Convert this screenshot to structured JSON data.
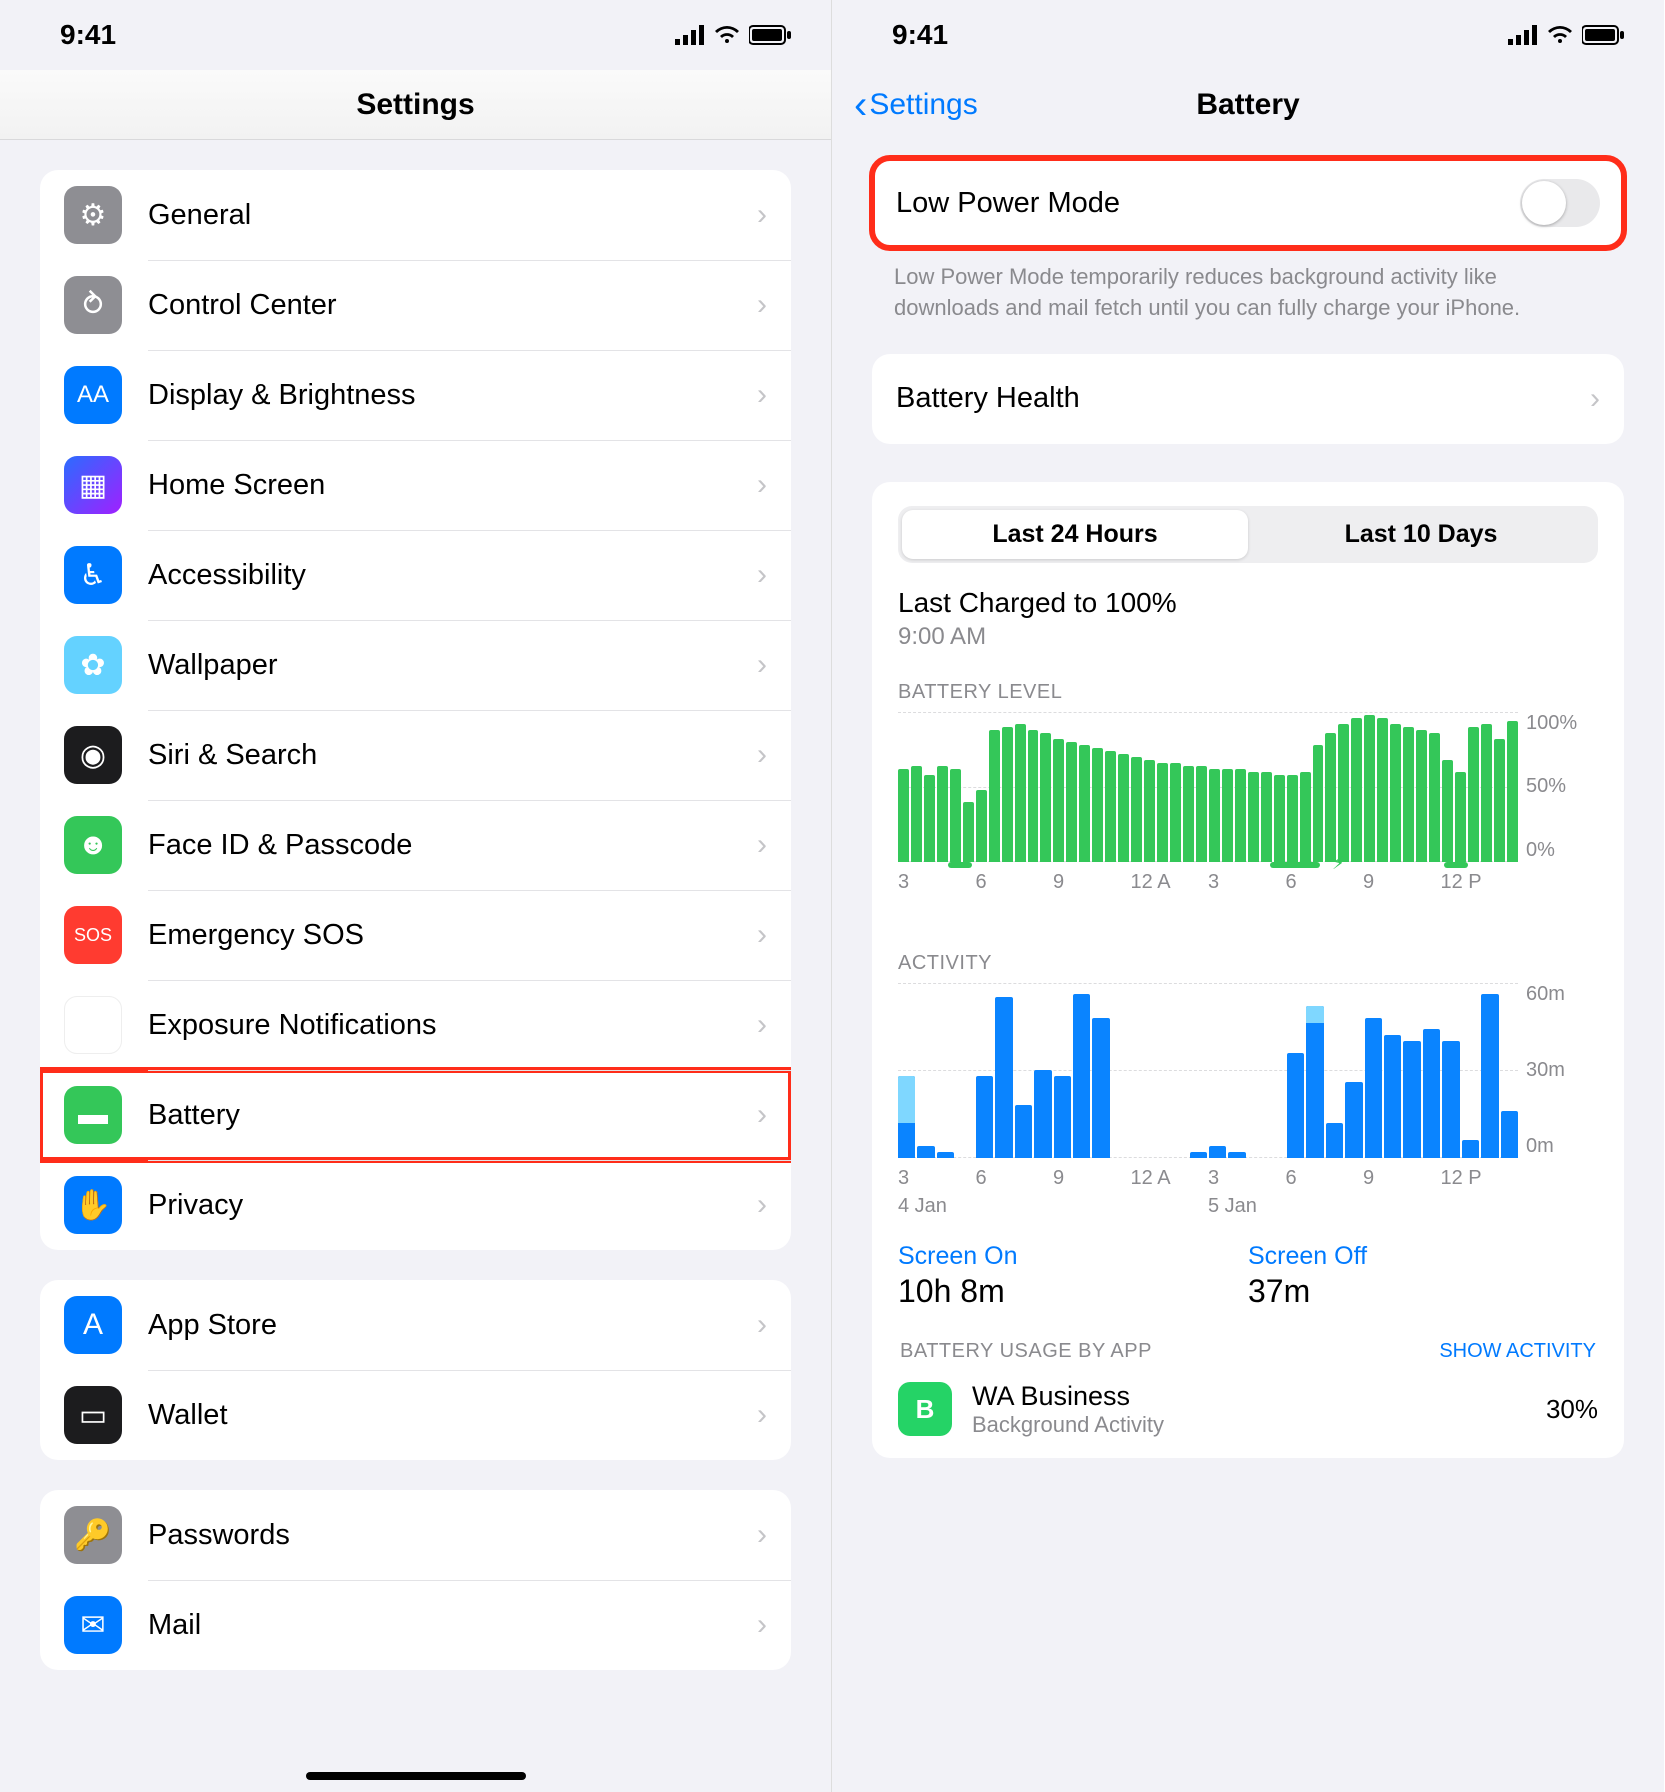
{
  "status": {
    "time": "9:41"
  },
  "left": {
    "title": "Settings",
    "groups": [
      [
        {
          "key": "general",
          "label": "General"
        },
        {
          "key": "control-center",
          "label": "Control Center"
        },
        {
          "key": "display",
          "label": "Display & Brightness"
        },
        {
          "key": "home-screen",
          "label": "Home Screen"
        },
        {
          "key": "accessibility",
          "label": "Accessibility"
        },
        {
          "key": "wallpaper",
          "label": "Wallpaper"
        },
        {
          "key": "siri",
          "label": "Siri & Search"
        },
        {
          "key": "faceid",
          "label": "Face ID & Passcode"
        },
        {
          "key": "sos",
          "label": "Emergency SOS"
        },
        {
          "key": "exposure",
          "label": "Exposure Notifications"
        },
        {
          "key": "battery",
          "label": "Battery",
          "highlight": true
        },
        {
          "key": "privacy",
          "label": "Privacy"
        }
      ],
      [
        {
          "key": "appstore",
          "label": "App Store"
        },
        {
          "key": "wallet",
          "label": "Wallet"
        }
      ],
      [
        {
          "key": "passwords",
          "label": "Passwords"
        },
        {
          "key": "mail",
          "label": "Mail"
        }
      ]
    ]
  },
  "right": {
    "back": "Settings",
    "title": "Battery",
    "low_power": {
      "label": "Low Power Mode",
      "on": false,
      "highlight": true
    },
    "low_power_note": "Low Power Mode temporarily reduces background activity like downloads and mail fetch until you can fully charge your iPhone.",
    "battery_health": "Battery Health",
    "segments": {
      "a": "Last 24 Hours",
      "b": "Last 10 Days",
      "active": "a"
    },
    "charged": {
      "title": "Last Charged to 100%",
      "time": "9:00 AM"
    },
    "level_label": "BATTERY LEVEL",
    "activity_label": "ACTIVITY",
    "x_ticks": [
      "3",
      "6",
      "9",
      "12 A",
      "3",
      "6",
      "9",
      "12 P"
    ],
    "x_dates": [
      "4 Jan",
      "5 Jan"
    ],
    "level_yticks": [
      "100%",
      "50%",
      "0%"
    ],
    "activity_yticks": [
      "60m",
      "30m",
      "0m"
    ],
    "screen_on": {
      "k": "Screen On",
      "v": "10h 8m"
    },
    "screen_off": {
      "k": "Screen Off",
      "v": "37m"
    },
    "apps_label": "BATTERY USAGE BY APP",
    "show_activity": "SHOW ACTIVITY",
    "app": {
      "name": "WA Business",
      "sub": "Background Activity",
      "pct": "30%"
    }
  },
  "chart_data": [
    {
      "type": "bar",
      "title": "BATTERY LEVEL",
      "ylabel": "%",
      "ylim": [
        0,
        100
      ],
      "x_ticks": [
        "3",
        "6",
        "9",
        "12 A",
        "3",
        "6",
        "9",
        "12 P"
      ],
      "values": [
        62,
        64,
        58,
        64,
        62,
        40,
        48,
        88,
        90,
        92,
        88,
        86,
        82,
        80,
        78,
        76,
        74,
        72,
        70,
        68,
        66,
        66,
        64,
        64,
        62,
        62,
        62,
        60,
        60,
        58,
        58,
        60,
        78,
        86,
        92,
        96,
        98,
        96,
        92,
        90,
        88,
        86,
        68,
        60,
        90,
        92,
        82,
        94
      ]
    },
    {
      "type": "bar",
      "title": "ACTIVITY",
      "ylabel": "minutes",
      "ylim": [
        0,
        60
      ],
      "x_ticks": [
        "3",
        "6",
        "9",
        "12 A",
        "3",
        "6",
        "9",
        "12 P"
      ],
      "series": [
        {
          "name": "screen-on",
          "values": [
            12,
            4,
            2,
            0,
            28,
            55,
            18,
            30,
            28,
            56,
            48,
            0,
            0,
            0,
            0,
            2,
            4,
            2,
            0,
            0,
            36,
            46,
            12,
            26,
            48,
            42,
            40,
            44,
            40,
            6,
            56,
            16
          ]
        },
        {
          "name": "screen-off-light",
          "values": [
            16,
            0,
            0,
            0,
            0,
            0,
            0,
            0,
            0,
            0,
            0,
            0,
            0,
            0,
            0,
            0,
            0,
            0,
            0,
            0,
            0,
            6,
            0,
            0,
            0,
            0,
            0,
            0,
            0,
            0,
            0,
            0
          ]
        }
      ]
    }
  ],
  "icons": {
    "general": "⚙︎",
    "control-center": "⥁",
    "display": "AA",
    "home-screen": "▦",
    "accessibility": "♿︎",
    "wallpaper": "✿",
    "siri": "◉",
    "faceid": "☻",
    "sos": "SOS",
    "exposure": "✺",
    "battery": "▬",
    "privacy": "✋",
    "appstore": "A",
    "wallet": "▭",
    "passwords": "🔑",
    "mail": "✉"
  },
  "icon_classes": {
    "general": "ic-gray",
    "control-center": "ic-gray",
    "display": "ic-blue",
    "home-screen": "ic-gradient",
    "accessibility": "ic-blue",
    "wallpaper": "ic-teal",
    "siri": "ic-dark",
    "faceid": "ic-green",
    "sos": "ic-red",
    "exposure": "ic-white",
    "battery": "ic-green",
    "privacy": "ic-blue",
    "appstore": "ic-blue",
    "wallet": "ic-dark",
    "passwords": "ic-gray",
    "mail": "ic-blue"
  }
}
